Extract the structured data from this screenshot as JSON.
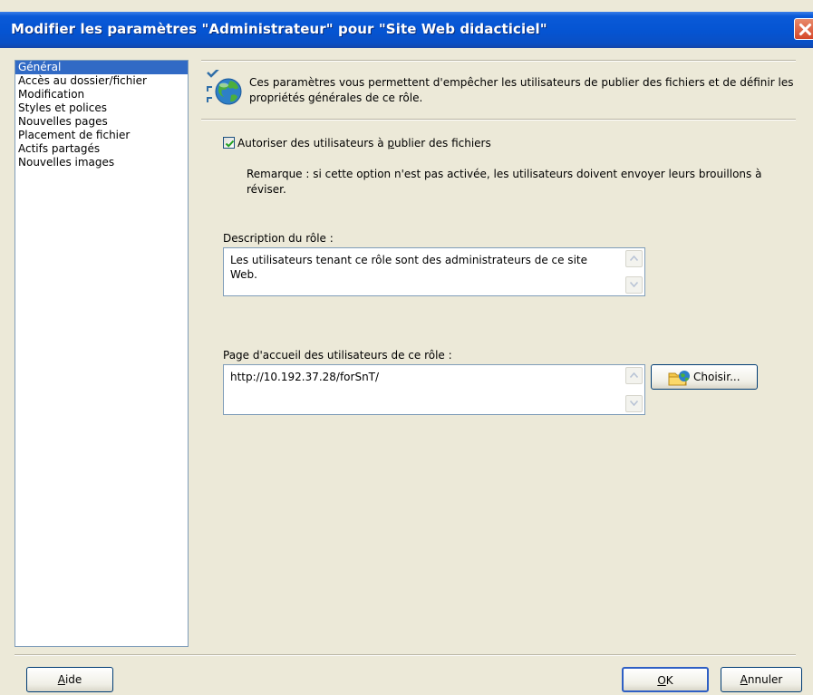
{
  "window": {
    "title": "Modifier les paramètres \"Administrateur\" pour \"Site Web didacticiel\"",
    "close_icon": "close-x-icon"
  },
  "nav": {
    "items": [
      {
        "label": "Général",
        "selected": true
      },
      {
        "label": "Accès au dossier/fichier",
        "selected": false
      },
      {
        "label": "Modification",
        "selected": false
      },
      {
        "label": "Styles et polices",
        "selected": false
      },
      {
        "label": "Nouvelles pages",
        "selected": false
      },
      {
        "label": "Placement de fichier",
        "selected": false
      },
      {
        "label": "Actifs partagés",
        "selected": false
      },
      {
        "label": "Nouvelles images",
        "selected": false
      }
    ]
  },
  "header": {
    "icon": "globe-checklist-icon",
    "text": "Ces paramètres vous permettent d'empêcher les utilisateurs de publier des fichiers et de définir les propriétés générales de ce rôle."
  },
  "publish": {
    "checked": true,
    "label_before": "Autoriser des utilisateurs à ",
    "label_mnemonic": "p",
    "label_after": "ublier des fichiers",
    "remark": "Remarque : si cette option n'est pas activée, les utilisateurs doivent envoyer leurs brouillons à réviser."
  },
  "description": {
    "label": "Description du rôle :",
    "value": "Les utilisateurs tenant ce rôle sont des administrateurs de ce site Web."
  },
  "homepage": {
    "label": "Page d'accueil des utilisateurs de ce rôle :",
    "value": "http://10.192.37.28/forSnT/",
    "choose_label": "Choisir..."
  },
  "footer": {
    "help_mnemonic": "A",
    "help_rest": "ide",
    "ok_mnemonic": "O",
    "ok_rest": "K",
    "cancel_mnemonic": "A",
    "cancel_rest": "nnuler"
  },
  "colors": {
    "titlebar": "#0554d2",
    "selection": "#316ac5",
    "dialog_bg": "#ece9d8"
  }
}
